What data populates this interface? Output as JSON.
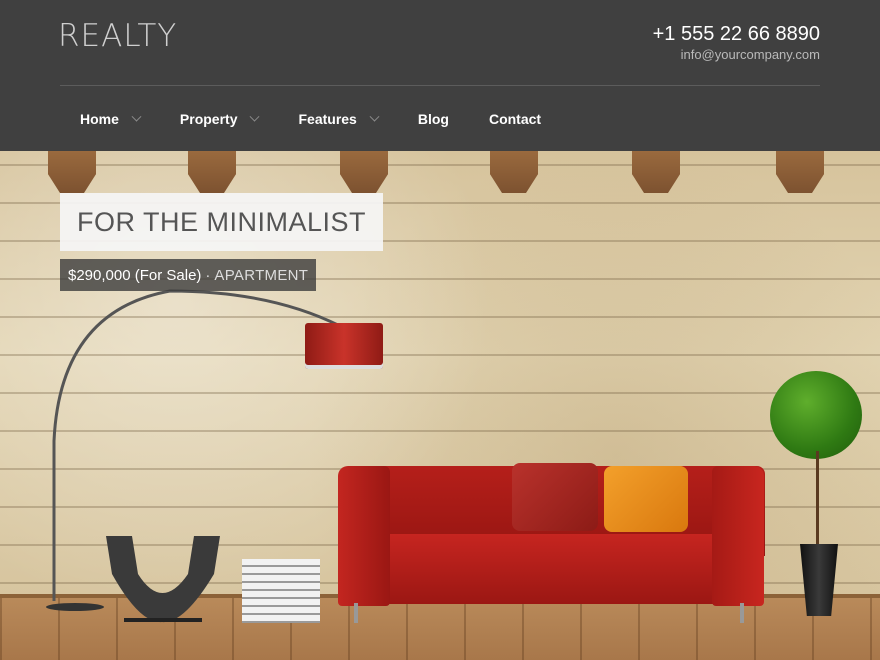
{
  "header": {
    "logo": "REALTY",
    "phone": "+1 555 22 66 8890",
    "email": "info@yourcompany.com"
  },
  "nav": {
    "items": [
      {
        "label": "Home",
        "has_dropdown": true
      },
      {
        "label": "Property",
        "has_dropdown": true
      },
      {
        "label": "Features",
        "has_dropdown": true
      },
      {
        "label": "Blog",
        "has_dropdown": false
      },
      {
        "label": "Contact",
        "has_dropdown": false
      }
    ]
  },
  "hero": {
    "title": "FOR THE MINIMALIST",
    "price": "$290,000 (For Sale)",
    "separator": "·",
    "type": "APARTMENT"
  },
  "colors": {
    "header_bg": "#404040",
    "text_light": "#ffffff",
    "sofa_red": "#b51f1a",
    "pillow_orange": "#e98c1c"
  }
}
